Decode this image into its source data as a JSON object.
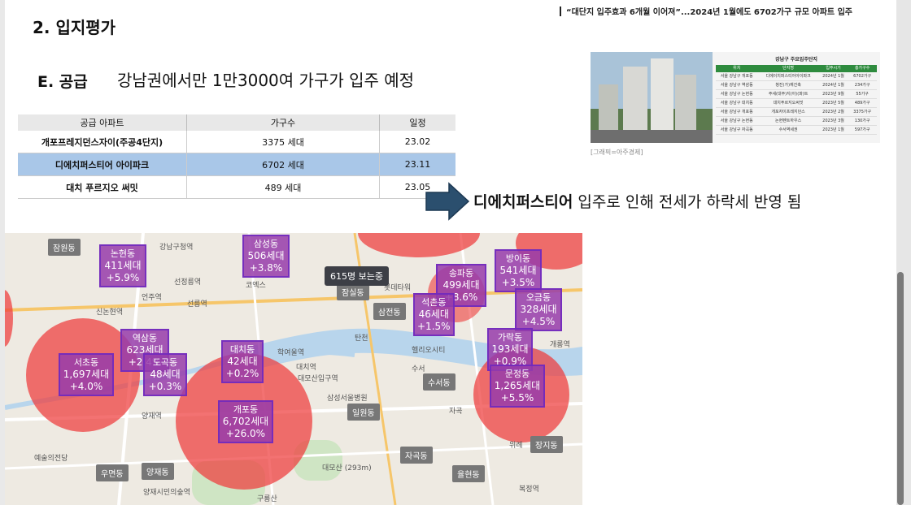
{
  "header": {
    "section_title": "2. 입지평가",
    "news_headline": "“대단지 입주효과 6개월 이어져”...2024년 1월에도 6702가구 규모 아파트 입주"
  },
  "subsection": {
    "label": "E. 공급",
    "text": "강남권에서만 1만3000여 가구가 입주 예정"
  },
  "supply_table": {
    "headers": [
      "공급 아파트",
      "가구수",
      "일정"
    ],
    "rows": [
      [
        "개포프레지던스자이(주공4단지)",
        "3375 세대",
        "23.02"
      ],
      [
        "디에치퍼스티어 아이파크",
        "6702 세대",
        "23.11"
      ],
      [
        "대치 푸르지오 써밋",
        "489 세대",
        "23.05"
      ]
    ],
    "highlight_row": 1
  },
  "news_image": {
    "caption": "[그래픽=아주경제]",
    "table_title": "강남구 주요입주단지",
    "table_headers": [
      "위치",
      "단지명",
      "입주시기",
      "총가구수"
    ],
    "table_rows": [
      [
        "서울 강남구 개포동",
        "디에이치퍼스티어아이파크",
        "2024년 1월",
        "6702가구"
      ],
      [
        "서울 강남구 역삼동",
        "청진(가)재건축",
        "2024년 1월",
        "234가구"
      ],
      [
        "서울 강남구 논현동",
        "주새(대주)지(아)(파)트",
        "2023년 9월",
        "55가구"
      ],
      [
        "서울 강남구 대치동",
        "대치푸르지오써밋",
        "2023년 5월",
        "489가구"
      ],
      [
        "서울 강남구 개포동",
        "개포자이프레지던스",
        "2023년 2월",
        "3375가구"
      ],
      [
        "서울 강남구 논현동",
        "논현펜트하우스",
        "2023년 3월",
        "130가구"
      ],
      [
        "서울 강남구 자곡동",
        "수서역세권",
        "2023년 1월",
        "597가구"
      ]
    ]
  },
  "conclusion": {
    "bold": "디에치퍼스티어",
    "rest": " 입주로 인해 전세가 하락세 반영 됨"
  },
  "map": {
    "popup": "615명 보는중",
    "markers": [
      {
        "name": "논현동",
        "units": "411세대",
        "change": "+5.9%"
      },
      {
        "name": "삼성동",
        "units": "506세대",
        "change": "+3.8%"
      },
      {
        "name": "송파동",
        "units": "499세대",
        "change": "+8.6%"
      },
      {
        "name": "방이동",
        "units": "541세대",
        "change": "+3.5%"
      },
      {
        "name": "오금동",
        "units": "328세대",
        "change": "+4.5%"
      },
      {
        "name": "역삼동",
        "units": "623세대",
        "change": "+2.4%"
      },
      {
        "name": "서초동",
        "units": "1,697세대",
        "change": "+4.0%"
      },
      {
        "name": "대치동",
        "units": "42세대",
        "change": "+0.2%"
      },
      {
        "name": "도곡동",
        "units": "48세대",
        "change": "+0.3%"
      },
      {
        "name": "개포동",
        "units": "6,702세대",
        "change": "+26.0%"
      },
      {
        "name": "가락동",
        "units": "193세대",
        "change": "+0.9%"
      },
      {
        "name": "문정동",
        "units": "1,265세대",
        "change": "+5.5%"
      },
      {
        "name": "석촌동",
        "units": "46세대",
        "change": "+1.5%"
      }
    ],
    "gray_tags": [
      "잠원동",
      "잠실동",
      "삼전동",
      "수서동",
      "일원동",
      "자곡동",
      "율현동",
      "장지동",
      "우면동",
      "양재동"
    ],
    "labels": [
      "강남구청역",
      "선정릉역",
      "선릉역",
      "언주역",
      "신논현역",
      "코엑스",
      "탄천",
      "헬리오시티",
      "수서",
      "대치역",
      "학여울역",
      "대모산입구역",
      "삼성서울병원",
      "양재역",
      "예술의전당",
      "구룡산",
      "대모산 (293m)",
      "롯데타워",
      "자곡",
      "복정역",
      "위례",
      "개롱역",
      "양재시민의숲역"
    ]
  }
}
